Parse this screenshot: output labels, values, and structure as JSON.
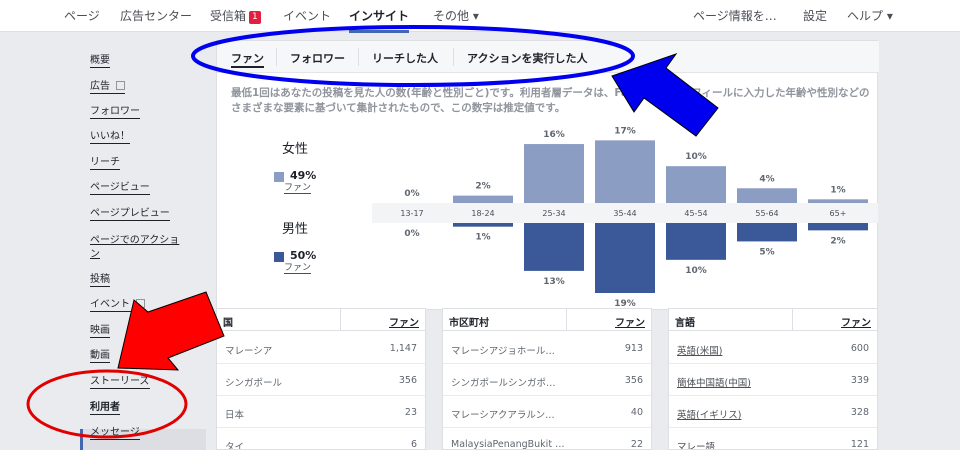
{
  "topnav": {
    "items": [
      {
        "label": "ページ"
      },
      {
        "label": "広告センター"
      },
      {
        "label": "受信箱",
        "badge": "1"
      },
      {
        "label": "イベント"
      },
      {
        "label": "インサイト"
      },
      {
        "label": "その他 ▾"
      },
      {
        "label": "ページ情報を…"
      },
      {
        "label": "設定"
      },
      {
        "label": "ヘルプ ▾"
      }
    ]
  },
  "sidebar": {
    "items": [
      {
        "label": "概要"
      },
      {
        "label": "広告"
      },
      {
        "label": "フォロワー"
      },
      {
        "label": "いいね！"
      },
      {
        "label": "リーチ"
      },
      {
        "label": "ページビュー"
      },
      {
        "label": "ページプレビュー"
      },
      {
        "label": "ページでのアクション"
      },
      {
        "label": "投稿"
      },
      {
        "label": "イベント"
      },
      {
        "label": "映画"
      },
      {
        "label": "動画"
      },
      {
        "label": "ストーリーズ"
      },
      {
        "label": "利用者"
      },
      {
        "label": "メッセージ"
      }
    ]
  },
  "tabs": [
    {
      "label": "ファン"
    },
    {
      "label": "フォロワー"
    },
    {
      "label": "リーチした人"
    },
    {
      "label": "アクションを実行した人"
    }
  ],
  "description": "最低1回はあなたの投稿を見た人の数(年齢と性別ごと)です。利用者層データは、Facebookプロフィールに入力した年齢や性別などのさまざまな要素に基づいて集計されたもので、この数字は推定値です。",
  "gender": {
    "female": {
      "label": "女性",
      "percent": "49%",
      "sub": "ファン",
      "color": "#8b9dc3"
    },
    "male": {
      "label": "男性",
      "percent": "50%",
      "sub": "ファン",
      "color": "#3b5998"
    }
  },
  "chart_data": {
    "type": "bar",
    "categories": [
      "13-17",
      "18-24",
      "25-34",
      "35-44",
      "45-54",
      "55-64",
      "65+"
    ],
    "series": [
      {
        "name": "女性",
        "values": [
          0,
          2,
          16,
          17,
          10,
          4,
          1
        ],
        "labels": [
          "0%",
          "2%",
          "16%",
          "17%",
          "10%",
          "4%",
          "1%"
        ],
        "color": "#8b9dc3"
      },
      {
        "name": "男性",
        "values": [
          0,
          1,
          13,
          19,
          10,
          5,
          2
        ],
        "labels": [
          "0%",
          "1%",
          "13%",
          "19%",
          "10%",
          "5%",
          "2%"
        ],
        "color": "#3b5998"
      }
    ],
    "ylim": [
      0,
      19
    ]
  },
  "tables": [
    {
      "header_left": "国",
      "header_right": "ファン",
      "rows": [
        {
          "name": "マレーシア",
          "value": "1,147"
        },
        {
          "name": "シンガポール",
          "value": "356"
        },
        {
          "name": "日本",
          "value": "23"
        },
        {
          "name": "タイ",
          "value": "6"
        }
      ]
    },
    {
      "header_left": "市区町村",
      "header_right": "ファン",
      "rows": [
        {
          "name": "マレーシアジョホール…",
          "value": "913"
        },
        {
          "name": "シンガポールシンガポ…",
          "value": "356"
        },
        {
          "name": "マレーシアクアラルン…",
          "value": "40"
        },
        {
          "name": "MalaysiaPenangBukit …",
          "value": "22"
        }
      ]
    },
    {
      "header_left": "言語",
      "header_right": "ファン",
      "rows": [
        {
          "name": "英語(米国)",
          "value": "600"
        },
        {
          "name": "簡体中国語(中国)",
          "value": "339"
        },
        {
          "name": "英語(イギリス)",
          "value": "328"
        },
        {
          "name": "マレー語",
          "value": "121"
        }
      ]
    }
  ],
  "colors": {
    "accent": "#4267b2",
    "annotation_blue": "#0000ee",
    "annotation_red": "#ff0000"
  }
}
